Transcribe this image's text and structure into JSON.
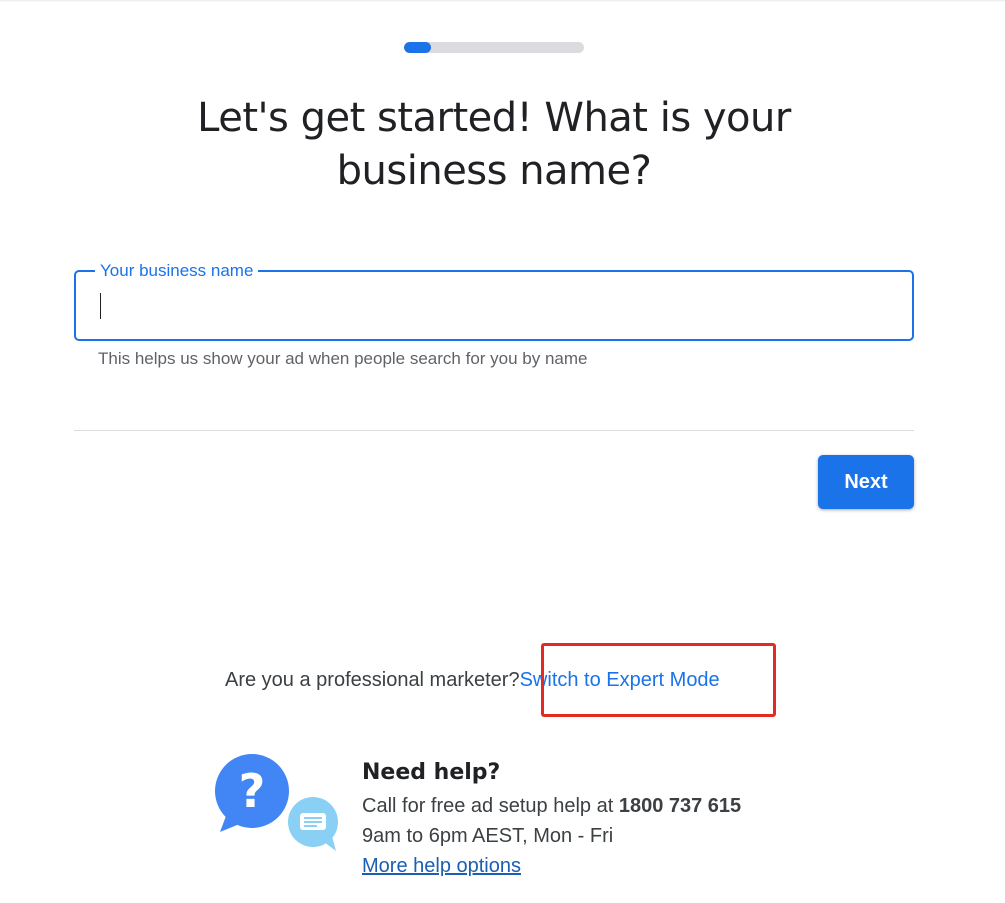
{
  "progress": {
    "value_fraction": 0.15,
    "fill_color": "#1a73e8",
    "track_color": "#dadce0"
  },
  "headline": "Let's get started! What is your business name?",
  "business_name_field": {
    "label": "Your business name",
    "value": "",
    "helper_text": "This helps us show your ad when people search for you by name"
  },
  "actions": {
    "next_label": "Next"
  },
  "expert_mode": {
    "prompt": "Are you a professional marketer?",
    "link_label": "Switch to Expert Mode",
    "highlight_color": "#e32b24"
  },
  "help": {
    "title": "Need help?",
    "call_text": "Call for free ad setup help at",
    "phone": "1800 737 615",
    "hours": "9am to 6pm AEST, Mon - Fri",
    "more_link": "More help options",
    "icons": [
      "question-bubble-icon",
      "chat-bubble-icon"
    ]
  },
  "colors": {
    "accent": "#1a73e8",
    "text": "#202124"
  }
}
